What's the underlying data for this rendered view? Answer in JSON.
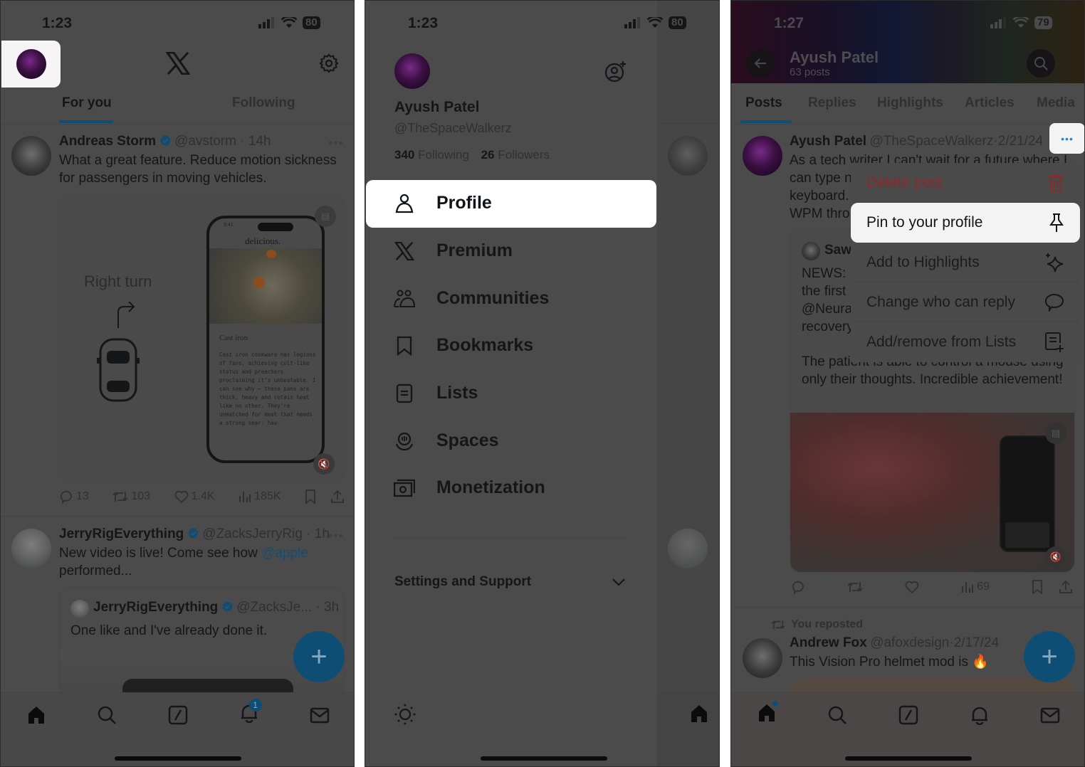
{
  "panel_home": {
    "status": {
      "time": "1:23",
      "battery": "80"
    },
    "header": {
      "logo": "X",
      "settings_icon": "gear-icon"
    },
    "tabs": [
      {
        "label": "For you",
        "active": true
      },
      {
        "label": "Following",
        "active": false
      }
    ],
    "tweets": [
      {
        "name": "Andreas Storm",
        "verified": true,
        "handle": "@avstorm",
        "time": "14h",
        "text": "What a great feature. Reduce motion sickness for passengers in moving vehicles.",
        "media": {
          "label": "Right turn",
          "phone_time": "9:41",
          "phone_app_title": "delicious.",
          "article_title": "Cast iron",
          "article_text": "Cast iron cookware has legions of fans, achieving cult-like status and preachers proclaiming it's unbeatable. I can see why – these pans are thick, heavy and retain heat like no other. They're unmatched for meat that needs a strong sear: hav-"
        },
        "stats": {
          "replies": "13",
          "reposts": "103",
          "likes": "1.4K",
          "views": "185K"
        }
      },
      {
        "name": "JerryRigEverything",
        "verified": true,
        "handle": "@ZacksJerryRig",
        "time": "1h",
        "text_before_mention": "New video is live! Come see how ",
        "mention": "@apple",
        "text_after_mention": "performed...",
        "quote": {
          "name": "JerryRigEverything",
          "handle": "@ZacksJe...",
          "time": "3h",
          "text": "One like and I've already done it."
        }
      }
    ],
    "fab_label": "+",
    "nav": {
      "notifications_badge": "1"
    }
  },
  "panel_drawer": {
    "status": {
      "time": "1:23",
      "battery": "80"
    },
    "profile": {
      "name": "Ayush Patel",
      "handle": "@TheSpaceWalkerz",
      "following_count": "340",
      "following_label": "Following",
      "followers_count": "26",
      "followers_label": "Followers"
    },
    "menu": [
      {
        "label": "Profile",
        "icon": "person-icon",
        "highlighted": true
      },
      {
        "label": "Premium",
        "icon": "x-logo-icon"
      },
      {
        "label": "Communities",
        "icon": "communities-icon"
      },
      {
        "label": "Bookmarks",
        "icon": "bookmark-icon"
      },
      {
        "label": "Lists",
        "icon": "list-icon"
      },
      {
        "label": "Spaces",
        "icon": "spaces-icon"
      },
      {
        "label": "Monetization",
        "icon": "money-icon"
      }
    ],
    "settings_label": "Settings and Support"
  },
  "panel_profile": {
    "status": {
      "time": "1:27",
      "battery": "79"
    },
    "header": {
      "name": "Ayush Patel",
      "posts_count": "63 posts"
    },
    "tabs": [
      {
        "label": "Posts",
        "active": true
      },
      {
        "label": "Replies"
      },
      {
        "label": "Highlights"
      },
      {
        "label": "Articles"
      },
      {
        "label": "Media"
      }
    ],
    "post": {
      "name": "Ayush Patel",
      "handle": "@TheSpaceWalkerz",
      "date": "2/21/24",
      "text_lines": [
        "As a tech writer I can't wait for a future where I",
        "can type n",
        "keyboard.",
        "WPM thro"
      ],
      "quote": {
        "name": "Saw",
        "text_lines": [
          "NEWS: E",
          "the first",
          "@Neura",
          "recovery"
        ],
        "text_more": "The patient is able to control a mouse using only their thoughts. Incredible achievement!"
      },
      "stats": {
        "views": "69"
      }
    },
    "context_menu": [
      {
        "label": "Delete post",
        "icon": "trash-icon",
        "danger": true
      },
      {
        "label": "Pin to your profile",
        "icon": "pin-icon",
        "highlighted": true
      },
      {
        "label": "Add to Highlights",
        "icon": "sparkle-icon"
      },
      {
        "label": "Change who can reply",
        "icon": "speech-bubble-icon"
      },
      {
        "label": "Add/remove from Lists",
        "icon": "list-add-icon"
      }
    ],
    "repost": {
      "context": "You reposted",
      "name": "Andrew Fox",
      "handle": "@afoxdesign",
      "date": "2/17/24",
      "text": "This Vision Pro helmet mod is 🔥"
    },
    "fab_label": "+"
  }
}
